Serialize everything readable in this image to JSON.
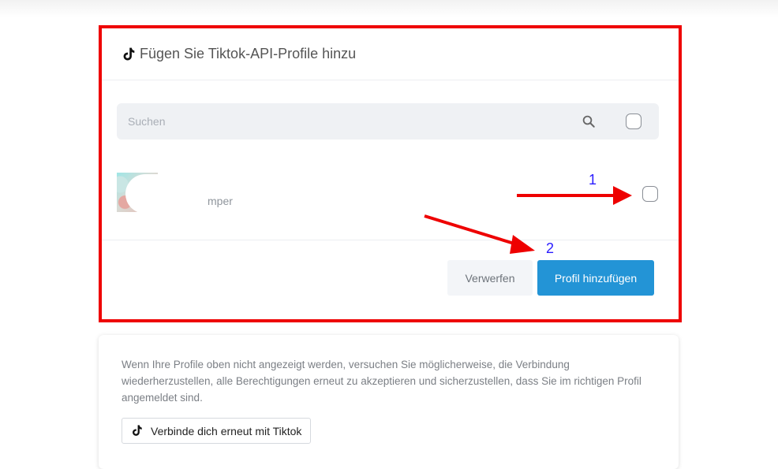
{
  "modal": {
    "title": "Fügen Sie Tiktok-API-Profile hinzu",
    "search_placeholder": "Suchen",
    "profiles": [
      {
        "name": "mper"
      }
    ],
    "buttons": {
      "discard_label": "Verwerfen",
      "add_label": "Profil hinzufügen"
    }
  },
  "annotations": {
    "step1": "1",
    "step2": "2",
    "arrow_color": "#ee0000",
    "number_color": "#2a1cff",
    "highlight_border_color": "#ee0000"
  },
  "info": {
    "text": "Wenn Ihre Profile oben nicht angezeigt werden, versuchen Sie möglicherweise, die Verbindung wiederherzustellen, alle Berechtigungen erneut zu akzeptieren und sicherzustellen, dass Sie im richtigen Profil angemeldet sind.",
    "reconnect_label": "Verbinde dich erneut mit Tiktok"
  },
  "colors": {
    "primary": "#2394d6",
    "search_bg": "#eff1f4"
  },
  "icons": {
    "header": "tiktok-icon",
    "search": "search-icon",
    "reconnect": "tiktok-icon"
  }
}
